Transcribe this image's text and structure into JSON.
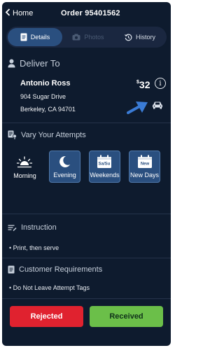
{
  "header": {
    "back_label": "Home",
    "order_title": "Order 95401562"
  },
  "tabs": [
    {
      "label": "Details",
      "active": true,
      "icon": "document-icon"
    },
    {
      "label": "Photos",
      "active": false,
      "icon": "camera-icon"
    },
    {
      "label": "History",
      "active": false,
      "icon": "history-icon"
    }
  ],
  "deliver_to": {
    "title": "Deliver To",
    "name": "Antonio Ross",
    "address_line1": "904 Sugar Drive",
    "address_line2": "Berkeley, CA 94701",
    "price_symbol": "$",
    "price_value": "32"
  },
  "attempts": {
    "title": "Vary Your Attempts",
    "options": [
      {
        "label": "Morning",
        "selected": false,
        "icon": "sunrise-icon"
      },
      {
        "label": "Evening",
        "selected": true,
        "icon": "moon-icon"
      },
      {
        "label": "Weekends",
        "selected": true,
        "icon": "calendar-weekend-icon",
        "icon_text": "Sa/Su"
      },
      {
        "label": "New Days",
        "selected": true,
        "icon": "calendar-new-icon",
        "icon_text": "New"
      }
    ]
  },
  "instruction": {
    "title": "Instruction",
    "items": [
      "Print, then serve"
    ]
  },
  "requirements": {
    "title": "Customer Requirements",
    "items": [
      "Do Not Leave Attempt Tags"
    ]
  },
  "actions": {
    "rejected_label": "Rejected",
    "received_label": "Received"
  },
  "colors": {
    "background": "#0e1b2e",
    "accent": "#2a4f7f",
    "rejected": "#e0222f",
    "received": "#6bbf49",
    "arrow": "#3a7bd5"
  }
}
